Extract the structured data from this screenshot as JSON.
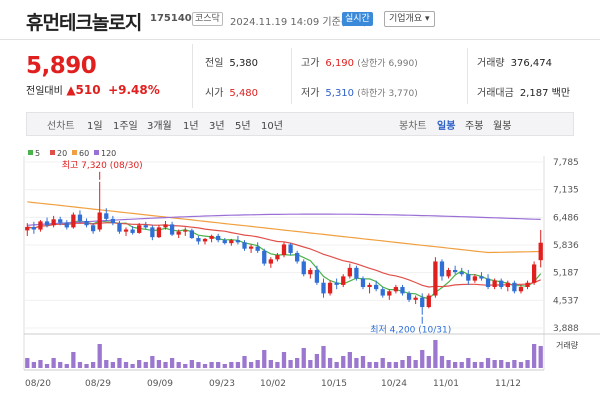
{
  "stock": {
    "name": "휴먼테크놀로지",
    "code": "175140",
    "market_tag": "코스닥",
    "datetime": "2024.11.19 14:09 기준(장중)",
    "realtime_tag": "실시간",
    "corp_overview": "기업개요 ▾"
  },
  "price": {
    "current": "5,890",
    "change_label": "전일대비",
    "change_amount": "▲510",
    "change_rate": "+9.48%"
  },
  "quote": {
    "prev_label": "전일",
    "prev_value": "5,380",
    "high_label": "고가",
    "high_value": "6,190",
    "high_limit": "(상한가 6,990)",
    "volume_label": "거래량",
    "volume_value": "376,474",
    "open_label": "시가",
    "open_value": "5,480",
    "low_label": "저가",
    "low_value": "5,310",
    "low_limit": "(하한가 3,770)",
    "amount_label": "거래대금",
    "amount_value": "2,187 백만"
  },
  "tabs": {
    "line_label": "선차트",
    "periods": [
      "1일",
      "1주일",
      "3개월",
      "1년",
      "3년",
      "5년",
      "10년"
    ],
    "candle_label": "봉차트",
    "candle_periods": [
      "일봉",
      "주봉",
      "월봉"
    ],
    "active_candle": "일봉"
  },
  "colors": {
    "up": "#e01f1f",
    "down": "#2f6fd6",
    "ma5": "#4bb34b",
    "ma20": "#e0504a",
    "ma60": "#f0a040",
    "ma120": "#9a6fd6"
  },
  "chart_data": {
    "type": "candlestick",
    "legend": [
      "5",
      "20",
      "60",
      "120"
    ],
    "y_ticks": [
      3888,
      4537,
      5187,
      5836,
      6486,
      7135,
      7785
    ],
    "y_tick_labels": [
      "3,888",
      "4,537",
      "5,187",
      "5,836",
      "6,486",
      "7,135",
      "7,785"
    ],
    "ylim": [
      3888,
      7785
    ],
    "x_labels": [
      "08/20",
      "08/29",
      "09/09",
      "09/23",
      "10/02",
      "10/15",
      "10/24",
      "11/01",
      "11/12"
    ],
    "annotation_high": "최고 7,320 (08/30)",
    "annotation_low": "최저 4,200 (10/31)",
    "volume_label": "거래량",
    "candles": [
      [
        6180,
        6350,
        6050,
        6260
      ],
      [
        6260,
        6380,
        6100,
        6200
      ],
      [
        6200,
        6420,
        6150,
        6390
      ],
      [
        6390,
        6480,
        6250,
        6300
      ],
      [
        6300,
        6520,
        6250,
        6440
      ],
      [
        6440,
        6500,
        6300,
        6360
      ],
      [
        6360,
        6420,
        6200,
        6250
      ],
      [
        6250,
        6600,
        6220,
        6550
      ],
      [
        6550,
        6650,
        6350,
        6400
      ],
      [
        6400,
        6460,
        6250,
        6300
      ],
      [
        6300,
        6350,
        6100,
        6160
      ],
      [
        6200,
        7320,
        6150,
        6600
      ],
      [
        6580,
        6700,
        6400,
        6450
      ],
      [
        6450,
        6520,
        6300,
        6350
      ],
      [
        6350,
        6400,
        6100,
        6150
      ],
      [
        6150,
        6250,
        6050,
        6200
      ],
      [
        6200,
        6280,
        6080,
        6120
      ],
      [
        6120,
        6350,
        6100,
        6300
      ],
      [
        6300,
        6380,
        6200,
        6250
      ],
      [
        6250,
        6300,
        5950,
        6020
      ],
      [
        6020,
        6300,
        6000,
        6250
      ],
      [
        6250,
        6400,
        6200,
        6320
      ],
      [
        6320,
        6380,
        6050,
        6080
      ],
      [
        6080,
        6200,
        6000,
        6150
      ],
      [
        6150,
        6250,
        6050,
        6180
      ],
      [
        6180,
        6220,
        5980,
        6000
      ],
      [
        6000,
        6050,
        5850,
        5920
      ],
      [
        5920,
        6000,
        5850,
        5980
      ],
      [
        5980,
        6080,
        5900,
        6050
      ],
      [
        6050,
        6100,
        5900,
        5950
      ],
      [
        5950,
        6000,
        5850,
        5880
      ],
      [
        5880,
        5980,
        5820,
        5950
      ],
      [
        5950,
        6050,
        5850,
        5900
      ],
      [
        5900,
        5950,
        5700,
        5750
      ],
      [
        5750,
        5850,
        5650,
        5800
      ],
      [
        5800,
        5900,
        5650,
        5700
      ],
      [
        5700,
        5750,
        5350,
        5400
      ],
      [
        5400,
        5550,
        5300,
        5500
      ],
      [
        5500,
        5650,
        5450,
        5600
      ],
      [
        5600,
        5900,
        5550,
        5850
      ],
      [
        5850,
        5880,
        5600,
        5650
      ],
      [
        5650,
        5700,
        5400,
        5450
      ],
      [
        5450,
        5500,
        5100,
        5150
      ],
      [
        5150,
        5300,
        5050,
        5250
      ],
      [
        5250,
        5350,
        4900,
        4950
      ],
      [
        4950,
        5050,
        4600,
        4700
      ],
      [
        4700,
        5000,
        4650,
        4950
      ],
      [
        4950,
        5050,
        4800,
        4900
      ],
      [
        4900,
        5150,
        4850,
        5100
      ],
      [
        5100,
        5400,
        5050,
        5300
      ],
      [
        5300,
        5350,
        5000,
        5050
      ],
      [
        5050,
        5100,
        4800,
        4850
      ],
      [
        4850,
        4950,
        4700,
        4900
      ],
      [
        4900,
        5000,
        4750,
        4800
      ],
      [
        4800,
        4850,
        4600,
        4650
      ],
      [
        4650,
        4800,
        4550,
        4750
      ],
      [
        4750,
        4900,
        4700,
        4850
      ],
      [
        4850,
        4900,
        4650,
        4700
      ],
      [
        4700,
        4750,
        4500,
        4550
      ],
      [
        4550,
        4650,
        4450,
        4600
      ],
      [
        4600,
        4700,
        4200,
        4380
      ],
      [
        4380,
        4700,
        4350,
        4650
      ],
      [
        4650,
        5550,
        4600,
        5450
      ],
      [
        5450,
        5500,
        5000,
        5100
      ],
      [
        5100,
        5300,
        5050,
        5250
      ],
      [
        5250,
        5350,
        5150,
        5200
      ],
      [
        5200,
        5300,
        5100,
        5150
      ],
      [
        5150,
        5250,
        4900,
        5000
      ],
      [
        5000,
        5150,
        4950,
        5100
      ],
      [
        5100,
        5200,
        5000,
        5050
      ],
      [
        5050,
        5150,
        4800,
        4850
      ],
      [
        4850,
        5050,
        4800,
        5000
      ],
      [
        5000,
        5050,
        4800,
        4850
      ],
      [
        4850,
        5000,
        4750,
        4950
      ],
      [
        4950,
        5000,
        4700,
        4750
      ],
      [
        4750,
        4900,
        4700,
        4850
      ],
      [
        4850,
        5000,
        4800,
        4950
      ],
      [
        4950,
        5450,
        4900,
        5380
      ],
      [
        5480,
        6190,
        5310,
        5890
      ]
    ],
    "volumes": [
      5,
      3,
      4,
      2,
      5,
      3,
      2,
      8,
      3,
      2,
      3,
      12,
      4,
      3,
      5,
      3,
      2,
      4,
      3,
      6,
      4,
      3,
      5,
      3,
      2,
      4,
      3,
      2,
      3,
      3,
      2,
      3,
      3,
      6,
      3,
      4,
      9,
      4,
      3,
      8,
      4,
      5,
      10,
      4,
      7,
      11,
      5,
      3,
      6,
      8,
      5,
      6,
      3,
      3,
      5,
      3,
      3,
      4,
      6,
      4,
      9,
      6,
      14,
      6,
      4,
      3,
      3,
      5,
      3,
      3,
      5,
      4,
      4,
      3,
      4,
      3,
      4,
      12,
      11
    ]
  }
}
